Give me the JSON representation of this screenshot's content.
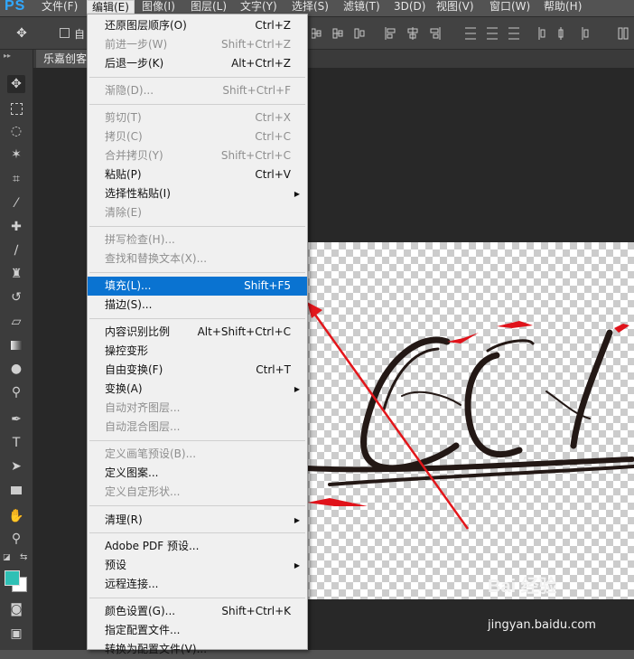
{
  "app": {
    "logo": "PS"
  },
  "menubar": {
    "items": [
      "文件(F)",
      "编辑(E)",
      "图像(I)",
      "图层(L)",
      "文字(Y)",
      "选择(S)",
      "滤镜(T)",
      "3D(D)",
      "视图(V)",
      "窗口(W)",
      "帮助(H)"
    ],
    "active_index": 1
  },
  "options_bar": {
    "auto_select_label": "自"
  },
  "document_tab": {
    "label": "乐嘉创客"
  },
  "edit_menu": {
    "items": [
      {
        "label": "还原图层顺序(O)",
        "shortcut": "Ctrl+Z",
        "enabled": true
      },
      {
        "label": "前进一步(W)",
        "shortcut": "Shift+Ctrl+Z",
        "enabled": false
      },
      {
        "label": "后退一步(K)",
        "shortcut": "Alt+Ctrl+Z",
        "enabled": true
      },
      {
        "label": "渐隐(D)...",
        "shortcut": "Shift+Ctrl+F",
        "enabled": false
      },
      {
        "label": "剪切(T)",
        "shortcut": "Ctrl+X",
        "enabled": false
      },
      {
        "label": "拷贝(C)",
        "shortcut": "Ctrl+C",
        "enabled": false
      },
      {
        "label": "合并拷贝(Y)",
        "shortcut": "Shift+Ctrl+C",
        "enabled": false
      },
      {
        "label": "粘贴(P)",
        "shortcut": "Ctrl+V",
        "enabled": true
      },
      {
        "label": "选择性粘贴(I)",
        "shortcut": "",
        "enabled": true,
        "submenu": true
      },
      {
        "label": "清除(E)",
        "shortcut": "",
        "enabled": false
      },
      {
        "label": "拼写检查(H)...",
        "shortcut": "",
        "enabled": false
      },
      {
        "label": "查找和替换文本(X)...",
        "shortcut": "",
        "enabled": false
      },
      {
        "label": "填充(L)...",
        "shortcut": "Shift+F5",
        "enabled": true,
        "highlighted": true
      },
      {
        "label": "描边(S)...",
        "shortcut": "",
        "enabled": true
      },
      {
        "label": "内容识别比例",
        "shortcut": "Alt+Shift+Ctrl+C",
        "enabled": true
      },
      {
        "label": "操控变形",
        "shortcut": "",
        "enabled": true
      },
      {
        "label": "自由变换(F)",
        "shortcut": "Ctrl+T",
        "enabled": true
      },
      {
        "label": "变换(A)",
        "shortcut": "",
        "enabled": true,
        "submenu": true
      },
      {
        "label": "自动对齐图层...",
        "shortcut": "",
        "enabled": false
      },
      {
        "label": "自动混合图层...",
        "shortcut": "",
        "enabled": false
      },
      {
        "label": "定义画笔预设(B)...",
        "shortcut": "",
        "enabled": false
      },
      {
        "label": "定义图案...",
        "shortcut": "",
        "enabled": true
      },
      {
        "label": "定义自定形状...",
        "shortcut": "",
        "enabled": false
      },
      {
        "label": "清理(R)",
        "shortcut": "",
        "enabled": true,
        "submenu": true
      },
      {
        "label": "Adobe PDF 预设...",
        "shortcut": "",
        "enabled": true
      },
      {
        "label": "预设",
        "shortcut": "",
        "enabled": true,
        "submenu": true
      },
      {
        "label": "远程连接...",
        "shortcut": "",
        "enabled": true
      },
      {
        "label": "颜色设置(G)...",
        "shortcut": "Shift+Ctrl+K",
        "enabled": true
      },
      {
        "label": "指定配置文件...",
        "shortcut": "",
        "enabled": true
      },
      {
        "label": "转换为配置文件(V)...",
        "shortcut": "",
        "enabled": true
      }
    ]
  },
  "colors": {
    "foreground": "#2fc0b5",
    "background": "#ffffff",
    "highlight": "#0a73d1"
  },
  "watermark": {
    "logo": "Bai 经验",
    "url": "jingyan.baidu.com"
  }
}
